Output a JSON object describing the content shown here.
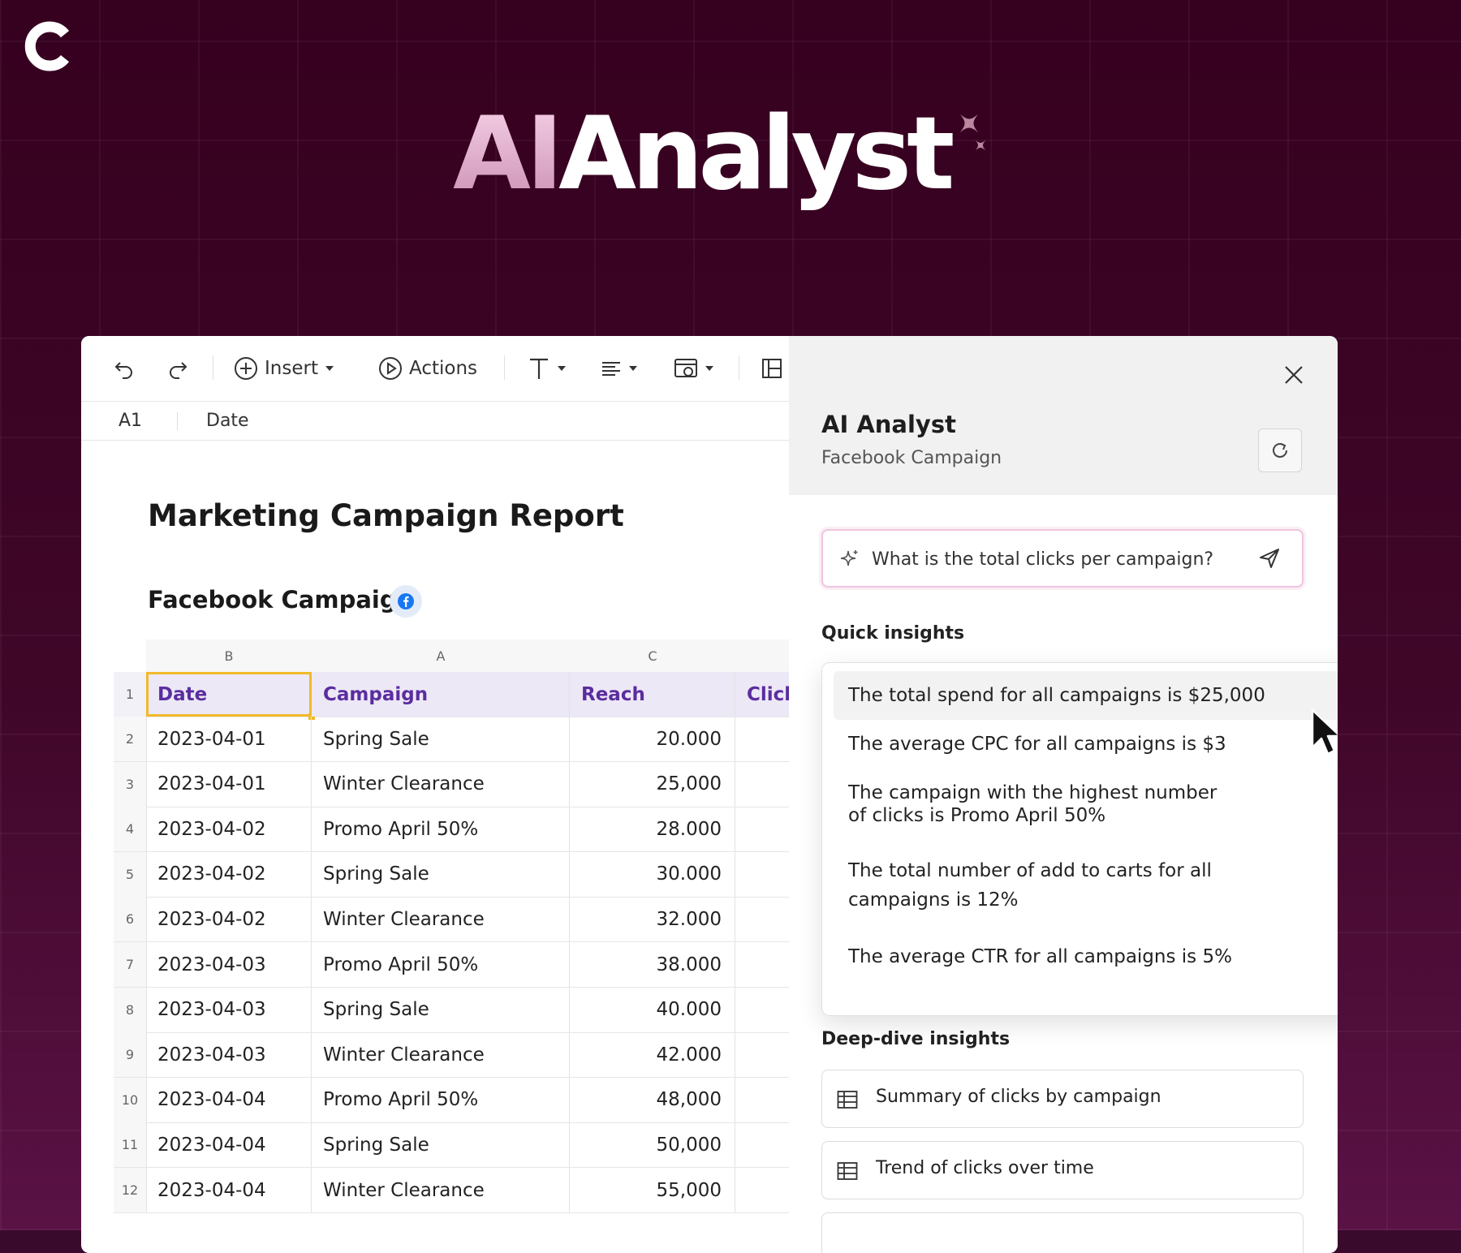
{
  "hero": {
    "ai": "AI",
    "analyst": "Analyst"
  },
  "toolbar": {
    "insert_label": "Insert",
    "actions_label": "Actions"
  },
  "formula_bar": {
    "cell_ref": "A1",
    "value": "Date"
  },
  "sheet": {
    "report_title": "Marketing Campaign Report",
    "section_title": "Facebook Campaign",
    "column_letters": [
      "B",
      "A",
      "C"
    ],
    "headers": {
      "num": "1",
      "date": "Date",
      "campaign": "Campaign",
      "reach": "Reach",
      "clicks": "Click"
    },
    "rows": [
      {
        "num": "2",
        "date": "2023-04-01",
        "campaign": "Spring Sale",
        "reach": "20.000"
      },
      {
        "num": "3",
        "date": "2023-04-01",
        "campaign": "Winter Clearance",
        "reach": "25,000"
      },
      {
        "num": "4",
        "date": "2023-04-02",
        "campaign": "Promo April 50%",
        "reach": "28.000"
      },
      {
        "num": "5",
        "date": "2023-04-02",
        "campaign": "Spring Sale",
        "reach": "30.000"
      },
      {
        "num": "6",
        "date": "2023-04-02",
        "campaign": "Winter Clearance",
        "reach": "32.000"
      },
      {
        "num": "7",
        "date": "2023-04-03",
        "campaign": "Promo April 50%",
        "reach": "38.000"
      },
      {
        "num": "8",
        "date": "2023-04-03",
        "campaign": "Spring Sale",
        "reach": "40.000"
      },
      {
        "num": "9",
        "date": "2023-04-03",
        "campaign": "Winter Clearance",
        "reach": "42.000"
      },
      {
        "num": "10",
        "date": "2023-04-04",
        "campaign": "Promo April 50%",
        "reach": "48,000"
      },
      {
        "num": "11",
        "date": "2023-04-04",
        "campaign": "Spring Sale",
        "reach": "50,000"
      },
      {
        "num": "12",
        "date": "2023-04-04",
        "campaign": "Winter Clearance",
        "reach": "55,000"
      }
    ]
  },
  "ai_panel": {
    "title": "AI Analyst",
    "subtitle": "Facebook Campaign",
    "query": "What is the total clicks per campaign?",
    "quick_insights_label": "Quick insights",
    "quick_insights": [
      "The total spend for all campaigns is $25,000",
      "The average CPC for all campaigns is $3",
      "The campaign with the highest number of clicks is Promo April 50%",
      "The total number of add to carts for all campaigns is 12%",
      "The average CTR for all campaigns is 5%"
    ],
    "more_label": "···",
    "deep_dive_label": "Deep-dive insights",
    "deep_dive": [
      "Summary of clicks by campaign",
      "Trend of clicks over time"
    ]
  },
  "colors": {
    "background": "#3a0a2c",
    "header_fill": "#ece8f6",
    "header_text": "#5b2d9e",
    "selection": "#f2b92a",
    "facebook_blue": "#1877f2"
  },
  "icons": [
    "brand-logo-icon",
    "sparkle-icon",
    "undo-icon",
    "redo-icon",
    "plus-circle-icon",
    "play-circle-icon",
    "text-format-icon",
    "align-icon",
    "chart-icon",
    "layout-icon",
    "facebook-icon",
    "close-icon",
    "refresh-icon",
    "magic-sparkle-icon",
    "send-icon",
    "cursor-icon",
    "table-icon"
  ]
}
